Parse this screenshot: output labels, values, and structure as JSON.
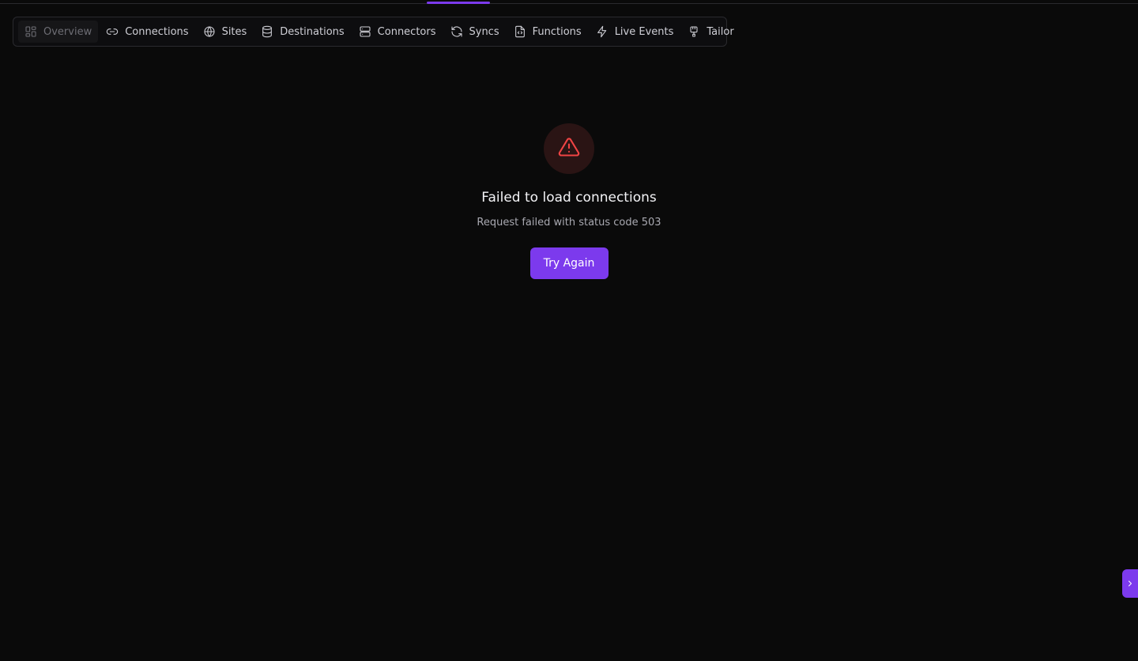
{
  "nav": {
    "items": [
      {
        "label": "Overview",
        "icon": "overview-icon",
        "active": true
      },
      {
        "label": "Connections",
        "icon": "link-icon"
      },
      {
        "label": "Sites",
        "icon": "globe-icon"
      },
      {
        "label": "Destinations",
        "icon": "database-icon"
      },
      {
        "label": "Connectors",
        "icon": "server-icon"
      },
      {
        "label": "Syncs",
        "icon": "refresh-icon"
      },
      {
        "label": "Functions",
        "icon": "file-code-icon"
      },
      {
        "label": "Live Events",
        "icon": "bolt-icon"
      },
      {
        "label": "Tailor",
        "icon": "plug-icon"
      }
    ]
  },
  "error": {
    "title": "Failed to load connections",
    "message": "Request failed with status code 503",
    "retry_label": "Try Again",
    "icon": "warning-icon"
  },
  "side_toggle": {
    "icon": "chevron-right-icon"
  },
  "colors": {
    "accent": "#7c3aed",
    "error": "#ef4444",
    "background": "#0a0a0a"
  }
}
